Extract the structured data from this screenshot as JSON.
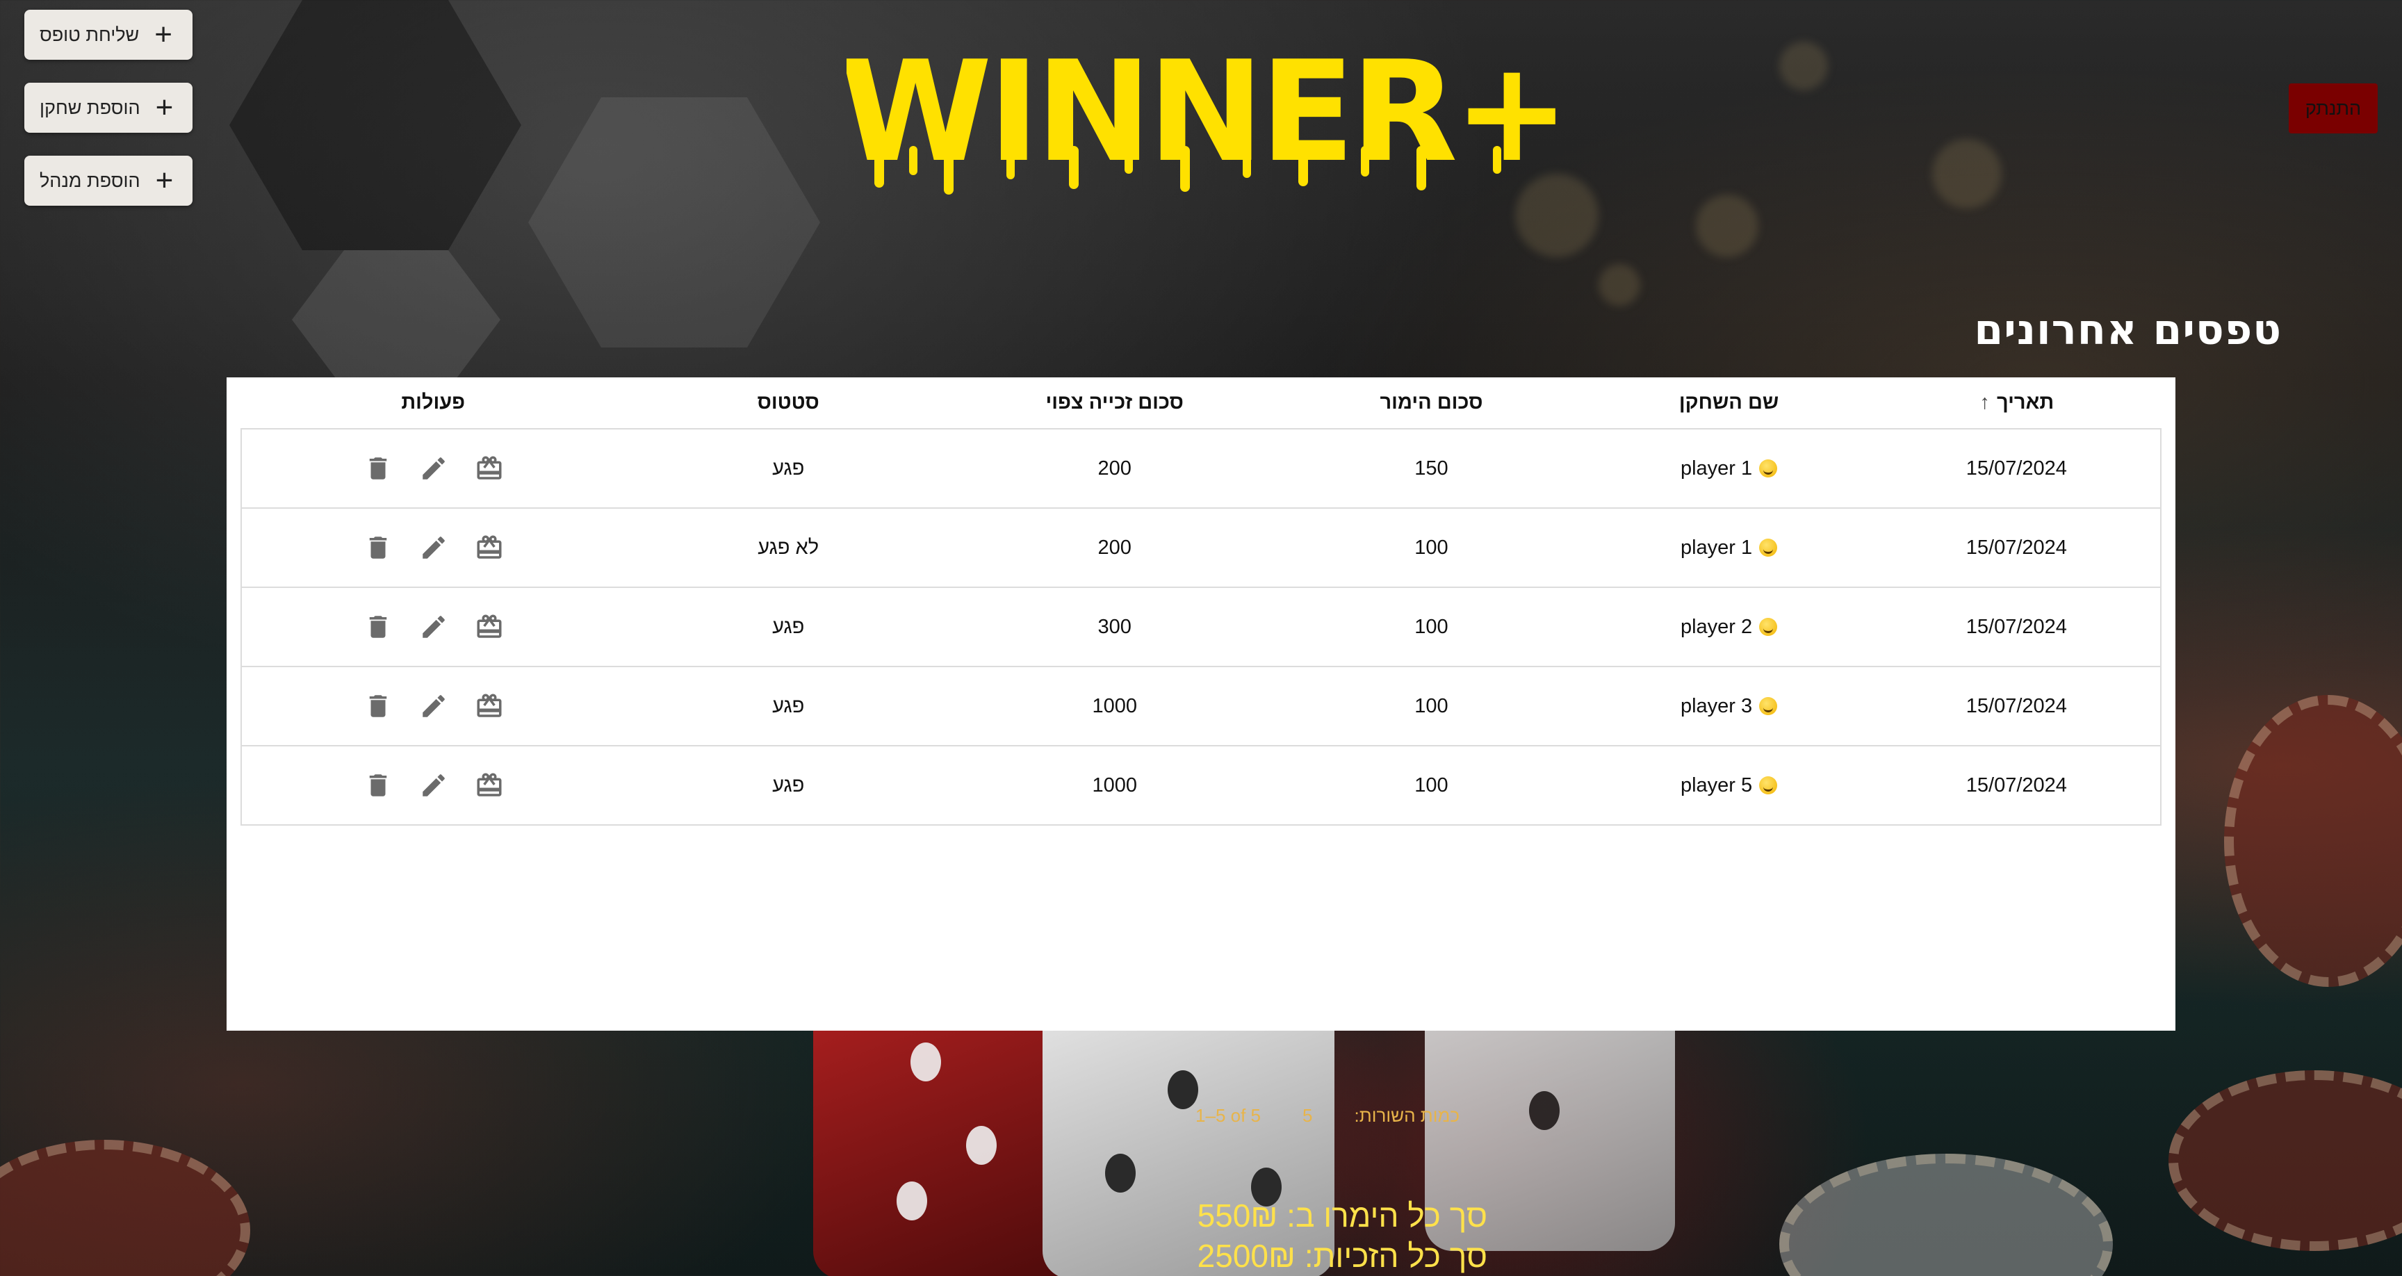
{
  "header": {
    "logo_text": "WINNER+",
    "logout_label": "התנתק",
    "actions": [
      {
        "label": "שליחת טופס",
        "icon": "plus-icon"
      },
      {
        "label": "הוספת שחקן",
        "icon": "plus-icon"
      },
      {
        "label": "הוספת מנהל",
        "icon": "plus-icon"
      }
    ]
  },
  "section": {
    "title": "טפסים אחרונים"
  },
  "table": {
    "columns": {
      "date": "תאריך",
      "player": "שם השחקן",
      "bet": "סכום הימור",
      "expected": "סכום זכייה צפוי",
      "status": "סטטוס",
      "actions": "פעולות"
    },
    "rows": [
      {
        "date": "15/07/2024",
        "player": "player 1",
        "bet": "150",
        "expected": "200",
        "status": "פגע",
        "status_color": "#1b7a1b"
      },
      {
        "date": "15/07/2024",
        "player": "player 1",
        "bet": "100",
        "expected": "200",
        "status": "לא פגע",
        "status_color": "#e01b1b"
      },
      {
        "date": "15/07/2024",
        "player": "player 2",
        "bet": "100",
        "expected": "300",
        "status": "פגע",
        "status_color": "#1b7a1b"
      },
      {
        "date": "15/07/2024",
        "player": "player 3",
        "bet": "100",
        "expected": "1000",
        "status": "פגע",
        "status_color": "#1b7a1b"
      },
      {
        "date": "15/07/2024",
        "player": "player 5",
        "bet": "100",
        "expected": "1000",
        "status": "פגע",
        "status_color": "#1b7a1b"
      }
    ],
    "row_icons": [
      "receipt-icon",
      "edit-icon",
      "trash-icon"
    ]
  },
  "pagination": {
    "rows_label": "כמות השורות:",
    "rows_value": "5",
    "range": "1–5 of 5"
  },
  "totals": {
    "bets_label": "סך כל הימרו ב:",
    "bets_value": "550₪",
    "wins_label": "סך כל הזכיות:",
    "wins_value": "2500₪"
  },
  "colors": {
    "logo": "#ffe100",
    "logout_bg": "#7a0000",
    "pagination_text": "#e8b44a",
    "totals_text": "#ffe14a"
  }
}
